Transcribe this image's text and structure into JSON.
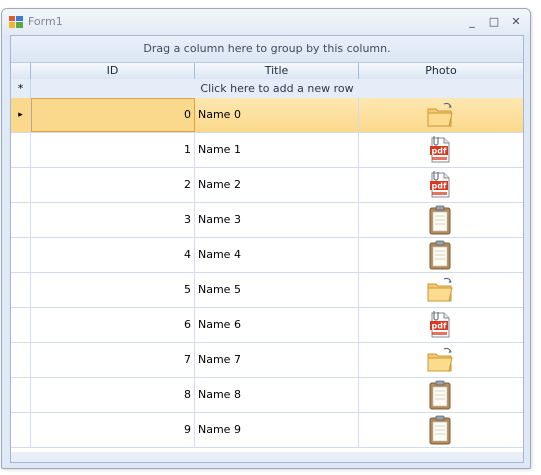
{
  "window": {
    "title": "Form1",
    "controls": {
      "minimize": "_",
      "maximize": "□",
      "close": "✕"
    }
  },
  "grid": {
    "group_panel_text": "Drag a column here to group by this column.",
    "columns": [
      "ID",
      "Title",
      "Photo"
    ],
    "new_row_indicator": "*",
    "new_row_text": "Click here to add a new row",
    "current_row_indicator": "▸",
    "rows": [
      {
        "id": "0",
        "title": "Name 0",
        "photo": "folder-icon",
        "selected": true
      },
      {
        "id": "1",
        "title": "Name 1",
        "photo": "pdf-icon"
      },
      {
        "id": "2",
        "title": "Name 2",
        "photo": "pdf-icon"
      },
      {
        "id": "3",
        "title": "Name 3",
        "photo": "clipboard-icon"
      },
      {
        "id": "4",
        "title": "Name 4",
        "photo": "clipboard-icon"
      },
      {
        "id": "5",
        "title": "Name 5",
        "photo": "folder-icon"
      },
      {
        "id": "6",
        "title": "Name 6",
        "photo": "pdf-icon"
      },
      {
        "id": "7",
        "title": "Name 7",
        "photo": "folder-icon"
      },
      {
        "id": "8",
        "title": "Name 8",
        "photo": "clipboard-icon"
      },
      {
        "id": "9",
        "title": "Name 9",
        "photo": "clipboard-icon"
      }
    ]
  },
  "colors": {
    "selection": "#fbd98c",
    "selection_border": "#e89e3a",
    "header": "#dbe5f2"
  }
}
